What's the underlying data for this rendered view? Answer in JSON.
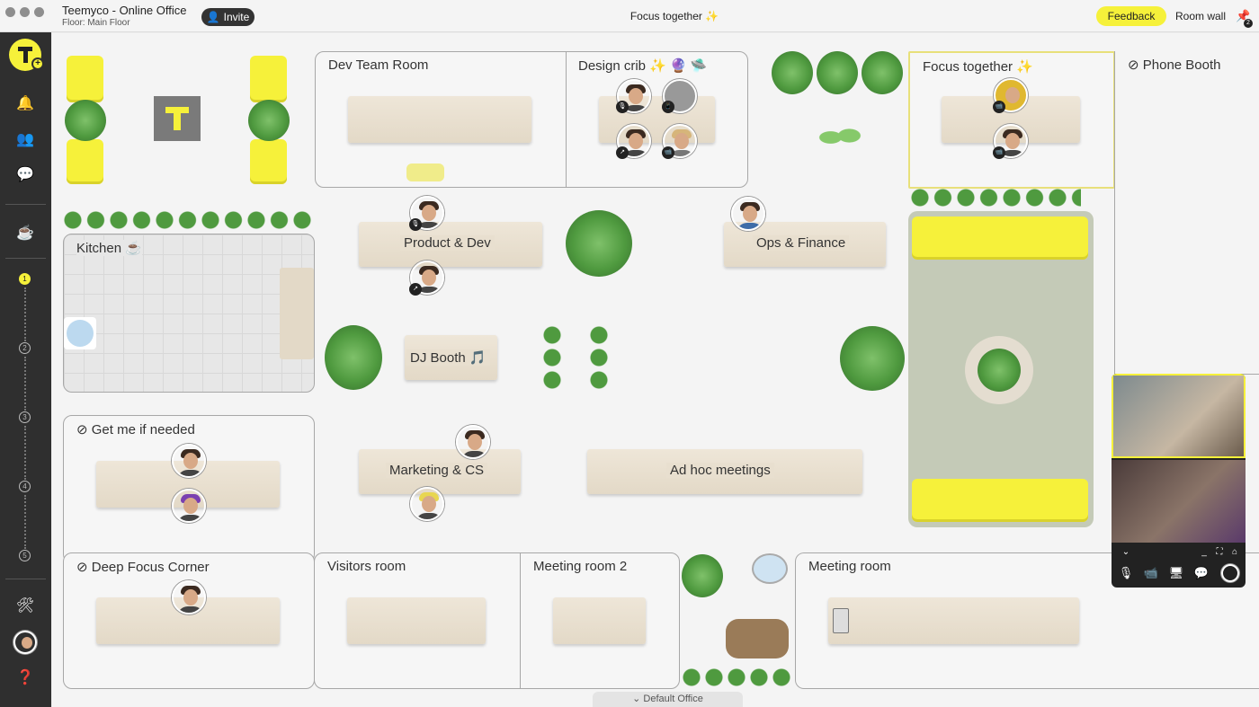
{
  "window": {
    "title": "Teemyco - Online Office",
    "floor": "Floor: Main Floor",
    "invite_label": "Invite",
    "center_title": "Focus together ✨",
    "feedback_label": "Feedback",
    "room_wall_label": "Room wall",
    "pin_count": "2"
  },
  "sidebar": {
    "floors": [
      "1",
      "2",
      "3",
      "4",
      "5"
    ]
  },
  "rooms": {
    "dev_team": "Dev Team Room",
    "design_crib": "Design crib ✨ 🔮 🛸",
    "focus_together": "Focus together ✨",
    "phone_booth": "Phone Booth",
    "kitchen": "Kitchen ☕",
    "get_me": "Get me if needed",
    "deep_focus": "Deep Focus Corner",
    "visitors": "Visitors room",
    "meeting2": "Meeting room 2",
    "meeting": "Meeting room"
  },
  "tables": {
    "product_dev": "Product & Dev",
    "ops_finance": "Ops & Finance",
    "dj_booth": "DJ Booth 🎵",
    "marketing_cs": "Marketing & CS",
    "adhoc": "Ad hoc meetings"
  },
  "bottom": {
    "office_tab": "Default Office"
  },
  "colors": {
    "accent": "#f6f13a",
    "sidebar": "#2f2f2f",
    "lounge": "#c4cab7"
  }
}
